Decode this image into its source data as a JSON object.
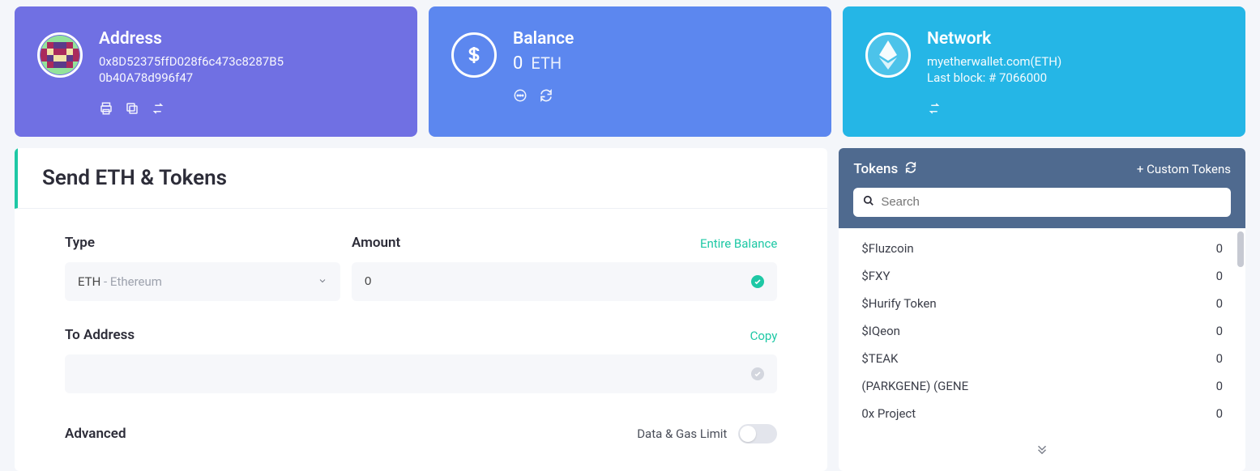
{
  "address": {
    "title": "Address",
    "line1": "0x8D52375ffD028f6c473c8287B5",
    "line2": "0b40A78d996f47"
  },
  "balance": {
    "title": "Balance",
    "value": "0",
    "unit": "ETH"
  },
  "network": {
    "title": "Network",
    "line1": "myetherwallet.com(ETH)",
    "line2": "Last block: # 7066000"
  },
  "send": {
    "title": "Send ETH & Tokens",
    "type_label": "Type",
    "amount_label": "Amount",
    "entire_balance": "Entire Balance",
    "token_symbol": "ETH",
    "token_name": " - Ethereum",
    "amount_value": "0",
    "to_label": "To Address",
    "copy": "Copy",
    "to_value": "",
    "advanced_label": "Advanced",
    "gas_label": "Data & Gas Limit"
  },
  "tokens": {
    "title": "Tokens",
    "add": "+ Custom Tokens",
    "search_placeholder": "Search",
    "items": [
      {
        "name": "$Fluzcoin",
        "balance": "0"
      },
      {
        "name": "$FXY",
        "balance": "0"
      },
      {
        "name": "$Hurify Token",
        "balance": "0"
      },
      {
        "name": "$IQeon",
        "balance": "0"
      },
      {
        "name": "$TEAK",
        "balance": "0"
      },
      {
        "name": "(PARKGENE) (GENE",
        "balance": "0"
      },
      {
        "name": "0x Project",
        "balance": "0"
      }
    ]
  }
}
